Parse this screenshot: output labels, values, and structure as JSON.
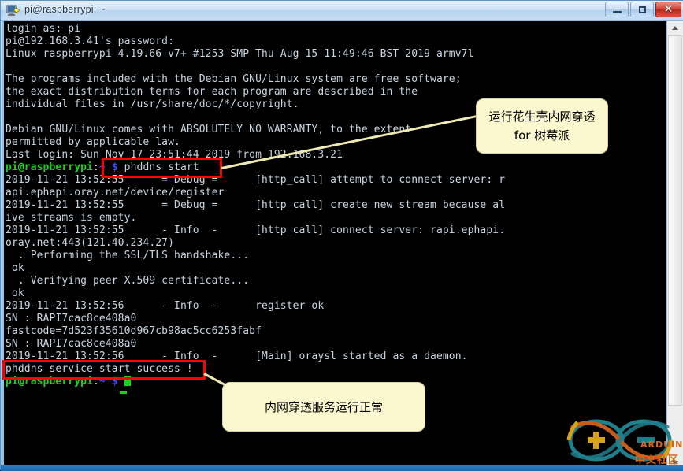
{
  "window": {
    "title": "pi@raspberrypi: ~",
    "icon": "putty-icon",
    "buttons": {
      "minimize": "–",
      "maximize": "□",
      "close": "✕"
    }
  },
  "terminal": {
    "lines": [
      {
        "segments": [
          {
            "text": "login as: pi",
            "color": "grey"
          }
        ]
      },
      {
        "segments": [
          {
            "text": "pi@192.168.3.41's password:",
            "color": "grey"
          }
        ]
      },
      {
        "segments": [
          {
            "text": "Linux raspberrypi 4.19.66-v7+ #1253 SMP Thu Aug 15 11:49:46 BST 2019 armv7l",
            "color": "grey"
          }
        ]
      },
      {
        "segments": [
          {
            "text": "",
            "color": "grey"
          }
        ]
      },
      {
        "segments": [
          {
            "text": "The programs included with the Debian GNU/Linux system are free software;",
            "color": "grey"
          }
        ]
      },
      {
        "segments": [
          {
            "text": "the exact distribution terms for each program are described in the",
            "color": "grey"
          }
        ]
      },
      {
        "segments": [
          {
            "text": "individual files in /usr/share/doc/*/copyright.",
            "color": "grey"
          }
        ]
      },
      {
        "segments": [
          {
            "text": "",
            "color": "grey"
          }
        ]
      },
      {
        "segments": [
          {
            "text": "Debian GNU/Linux comes with ABSOLUTELY NO WARRANTY, to the extent",
            "color": "grey"
          }
        ]
      },
      {
        "segments": [
          {
            "text": "permitted by applicable law.",
            "color": "grey"
          }
        ]
      },
      {
        "segments": [
          {
            "text": "Last login: Sun Nov 17 23:51:44 2019 from 192.168.3.21",
            "color": "grey"
          }
        ]
      },
      {
        "segments": [
          {
            "text": "pi@raspberrypi",
            "color": "green"
          },
          {
            "text": ":",
            "color": "grey"
          },
          {
            "text": "~",
            "color": "blue"
          },
          {
            "text": " ",
            "color": "grey"
          },
          {
            "text": "$",
            "color": "blue"
          },
          {
            "text": " phddns start",
            "color": "grey"
          }
        ]
      },
      {
        "segments": [
          {
            "text": "2019-11-21 13:52:55      = Debug =      [http_call] attempt to connect server: r",
            "color": "grey"
          }
        ]
      },
      {
        "segments": [
          {
            "text": "api.ephapi.oray.net/device/register",
            "color": "grey"
          }
        ]
      },
      {
        "segments": [
          {
            "text": "2019-11-21 13:52:55      = Debug =      [http_call] create new stream because al",
            "color": "grey"
          }
        ]
      },
      {
        "segments": [
          {
            "text": "ive streams is empty.",
            "color": "grey"
          }
        ]
      },
      {
        "segments": [
          {
            "text": "2019-11-21 13:52:55      - Info  -      [http_call] connect server: rapi.ephapi.",
            "color": "grey"
          }
        ]
      },
      {
        "segments": [
          {
            "text": "oray.net:443(121.40.234.27)",
            "color": "grey"
          }
        ]
      },
      {
        "segments": [
          {
            "text": "  . Performing the SSL/TLS handshake...",
            "color": "grey"
          }
        ]
      },
      {
        "segments": [
          {
            "text": " ok",
            "color": "grey"
          }
        ]
      },
      {
        "segments": [
          {
            "text": "  . Verifying peer X.509 certificate...",
            "color": "grey"
          }
        ]
      },
      {
        "segments": [
          {
            "text": " ok",
            "color": "grey"
          }
        ]
      },
      {
        "segments": [
          {
            "text": "2019-11-21 13:52:56      - Info  -      register ok",
            "color": "grey"
          }
        ]
      },
      {
        "segments": [
          {
            "text": "SN : RAPI7cac8ce408a0",
            "color": "grey"
          }
        ]
      },
      {
        "segments": [
          {
            "text": "fastcode=7d523f35610d967cb98ac5cc6253fabf",
            "color": "grey"
          }
        ]
      },
      {
        "segments": [
          {
            "text": "SN : RAPI7cac8ce408a0",
            "color": "grey"
          }
        ]
      },
      {
        "segments": [
          {
            "text": "2019-11-21 13:52:56      - Info  -      [Main] oraysl started as a daemon.",
            "color": "grey"
          }
        ]
      },
      {
        "segments": [
          {
            "text": "phddns service start success !",
            "color": "grey"
          }
        ]
      },
      {
        "segments": [
          {
            "text": "pi@raspberrypi",
            "color": "green"
          },
          {
            "text": ":",
            "color": "grey"
          },
          {
            "text": "~",
            "color": "blue"
          },
          {
            "text": " ",
            "color": "grey"
          },
          {
            "text": "$",
            "color": "blue"
          },
          {
            "text": " ",
            "color": "grey"
          }
        ],
        "cursor": true
      }
    ]
  },
  "annotations": {
    "callout_1": "运行花生壳内网穿透 for 树莓派",
    "callout_2": "内网穿透服务运行正常",
    "highlight_color": "#ff0000",
    "callout_bg": "#fbf8cf"
  },
  "watermark": {
    "brand": "ARDUINO",
    "brand_cn": "中文社区"
  },
  "scrollbar": {
    "up_arrow": "scroll-up-arrow",
    "down_arrow": "scroll-down-arrow"
  }
}
